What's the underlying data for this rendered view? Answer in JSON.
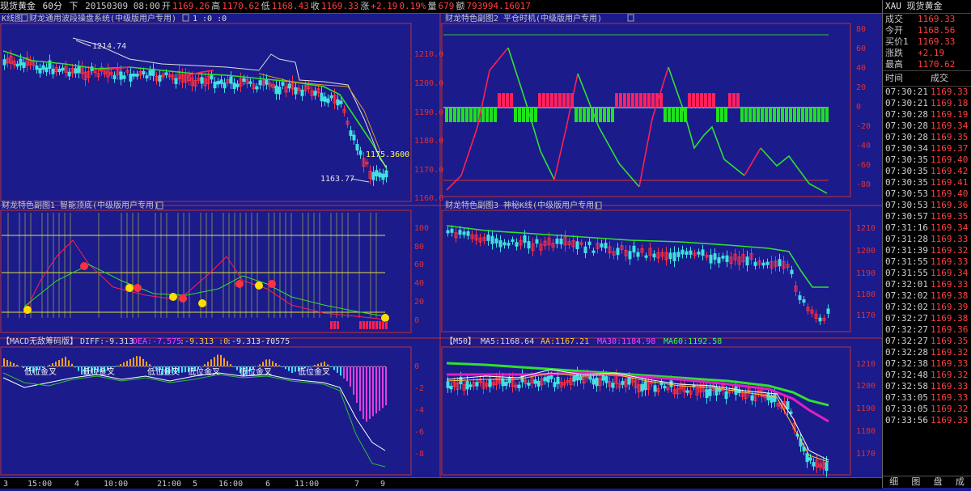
{
  "topbar": {
    "symbol": "现货黄金",
    "period": "60分",
    "down": "下",
    "datetime": "20150309 08:00",
    "open_label": "开",
    "open": "1169.26",
    "high_label": "高",
    "high": "1170.62",
    "low_label": "低",
    "low": "1168.43",
    "close_label": "收",
    "close": "1169.33",
    "change_label": "涨",
    "change": "+2.19",
    "pct": "0.19%",
    "vol_label": "量",
    "vol": "679",
    "amt_label": "额",
    "amt": "793994.16017"
  },
  "panel_main": {
    "title": "K线图",
    "subtitle": "财龙通用波段操盘系统(中级版用户专用)",
    "params": "1 :0 :0",
    "high_note": "1214.74",
    "low_note": "1163.77",
    "price_note": "1175.3600",
    "axis": [
      "1210.0",
      "1200.0",
      "1190.0",
      "1180.0",
      "1170.0",
      "1160.0"
    ]
  },
  "panel_sub2": {
    "title": "财龙特色副图2 平仓时机(中级版用户专用)",
    "axis": [
      "80",
      "60",
      "40",
      "20",
      "0",
      "-20",
      "-40",
      "-60",
      "-80"
    ]
  },
  "panel_sub1": {
    "title": "财龙特色副图1 智能顶底(中级版用户专用)",
    "axis": [
      "100",
      "80",
      "60",
      "40",
      "20",
      "0"
    ]
  },
  "panel_sub3": {
    "title": "财龙特色副图3 神秘K线(中级版用户专用)",
    "axis": [
      "1210",
      "1200",
      "1190",
      "1180",
      "1170"
    ]
  },
  "panel_macd": {
    "title": "【MACD无敌筹码版】",
    "diff": "DIFF:-9.313",
    "dea": "DEA:-7.575",
    "v1": ":-9.313 :0",
    "v2": ":-9.313 :0",
    "v3": ":-7.575",
    "cross_label": "低位金叉",
    "axis": [
      "0",
      "-2",
      "-4",
      "-6",
      "-8"
    ]
  },
  "panel_ma": {
    "title": "【M50】",
    "ma5": "MA5:1168.64",
    "aa": "AA:1167.21",
    "ma30": "MA30:1184.98",
    "ma60": "MA60:1192.58",
    "axis": [
      "1210",
      "1200",
      "1190",
      "1180",
      "1170"
    ]
  },
  "time_axis": [
    "3",
    "15:00",
    "4",
    "10:00",
    "21:00",
    "5",
    "16:00",
    "6",
    "11:00",
    "7",
    "9"
  ],
  "side": {
    "header": "XAU 现货黄金",
    "quotes": [
      {
        "k": "成交",
        "v": "1169.33"
      },
      {
        "k": "今开",
        "v": "1168.56"
      },
      {
        "k": "买价1",
        "v": "1169.33"
      },
      {
        "k": "涨跌",
        "v": "+2.19"
      },
      {
        "k": "最高",
        "v": "1170.62"
      }
    ],
    "col_time": "时间",
    "col_deal": "成交",
    "ticks": [
      [
        "07:30:21",
        "1169.33"
      ],
      [
        "07:30:21",
        "1169.18"
      ],
      [
        "07:30:28",
        "1169.19"
      ],
      [
        "07:30:28",
        "1169.34"
      ],
      [
        "07:30:28",
        "1169.35"
      ],
      [
        "07:30:34",
        "1169.37"
      ],
      [
        "07:30:35",
        "1169.40"
      ],
      [
        "07:30:35",
        "1169.42"
      ],
      [
        "07:30:35",
        "1169.41"
      ],
      [
        "07:30:53",
        "1169.40"
      ],
      [
        "07:30:53",
        "1169.36"
      ],
      [
        "07:30:57",
        "1169.35"
      ],
      [
        "07:31:16",
        "1169.34"
      ],
      [
        "07:31:28",
        "1169.33"
      ],
      [
        "07:31:39",
        "1169.32"
      ],
      [
        "07:31:55",
        "1169.33"
      ],
      [
        "07:31:55",
        "1169.34"
      ],
      [
        "07:32:01",
        "1169.33"
      ],
      [
        "07:32:02",
        "1169.38"
      ],
      [
        "07:32:02",
        "1169.39"
      ],
      [
        "07:32:27",
        "1169.38"
      ],
      [
        "07:32:27",
        "1169.36"
      ],
      [
        "07:32:27",
        "1169.35"
      ],
      [
        "07:32:28",
        "1169.32"
      ],
      [
        "07:32:38",
        "1169.33"
      ],
      [
        "07:32:48",
        "1169.32"
      ],
      [
        "07:32:58",
        "1169.33"
      ],
      [
        "07:33:05",
        "1169.33"
      ],
      [
        "07:33:05",
        "1169.32"
      ],
      [
        "07:33:56",
        "1169.33"
      ]
    ],
    "tabs": [
      "细",
      "图",
      "盘",
      "成"
    ]
  }
}
